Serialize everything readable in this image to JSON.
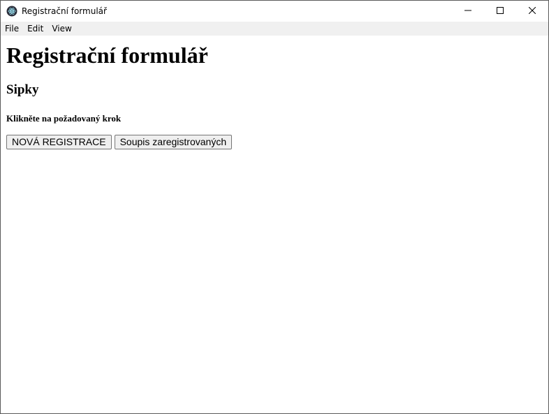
{
  "window": {
    "title": "Registrační formulář",
    "icon": "electron-app-icon",
    "controls": [
      "minimize-icon",
      "maximize-icon",
      "close-icon"
    ]
  },
  "menubar": {
    "items": [
      {
        "label": "File"
      },
      {
        "label": "Edit"
      },
      {
        "label": "View"
      }
    ]
  },
  "main": {
    "heading": "Registrační formulář",
    "subheading": "Sipky",
    "instruction": "Klikněte na požadovaný krok",
    "buttons": [
      {
        "label": "NOVÁ REGISTRACE"
      },
      {
        "label": "Soupis zaregistrovaných"
      }
    ]
  }
}
